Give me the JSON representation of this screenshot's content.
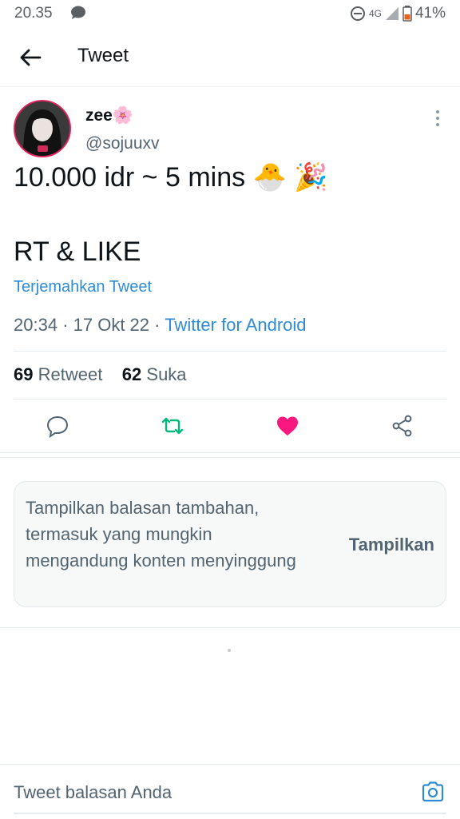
{
  "status": {
    "time": "20.35",
    "network": "4G",
    "battery": "41%"
  },
  "header": {
    "title": "Tweet"
  },
  "tweet": {
    "name": "zee🌸",
    "handle": "@sojuuxv",
    "line1": "10.000 idr ~ 5 mins 🐣 🎉",
    "line2": "RT & LIKE",
    "translate": "Terjemahkan Tweet",
    "time": "20:34",
    "date": "17 Okt 22",
    "source": "Twitter for Android",
    "retweet_count": "69",
    "retweet_label": "Retweet",
    "like_count": "62",
    "like_label": "Suka"
  },
  "notice": {
    "message": "Tampilkan balasan tambahan, termasuk yang mungkin mengandung konten menyinggung",
    "button": "Tampilkan"
  },
  "reply": {
    "placeholder": "Tweet balasan Anda"
  },
  "colors": {
    "like": "#f91880",
    "retweet": "#00ba7c",
    "link": "#2f8bd2"
  }
}
